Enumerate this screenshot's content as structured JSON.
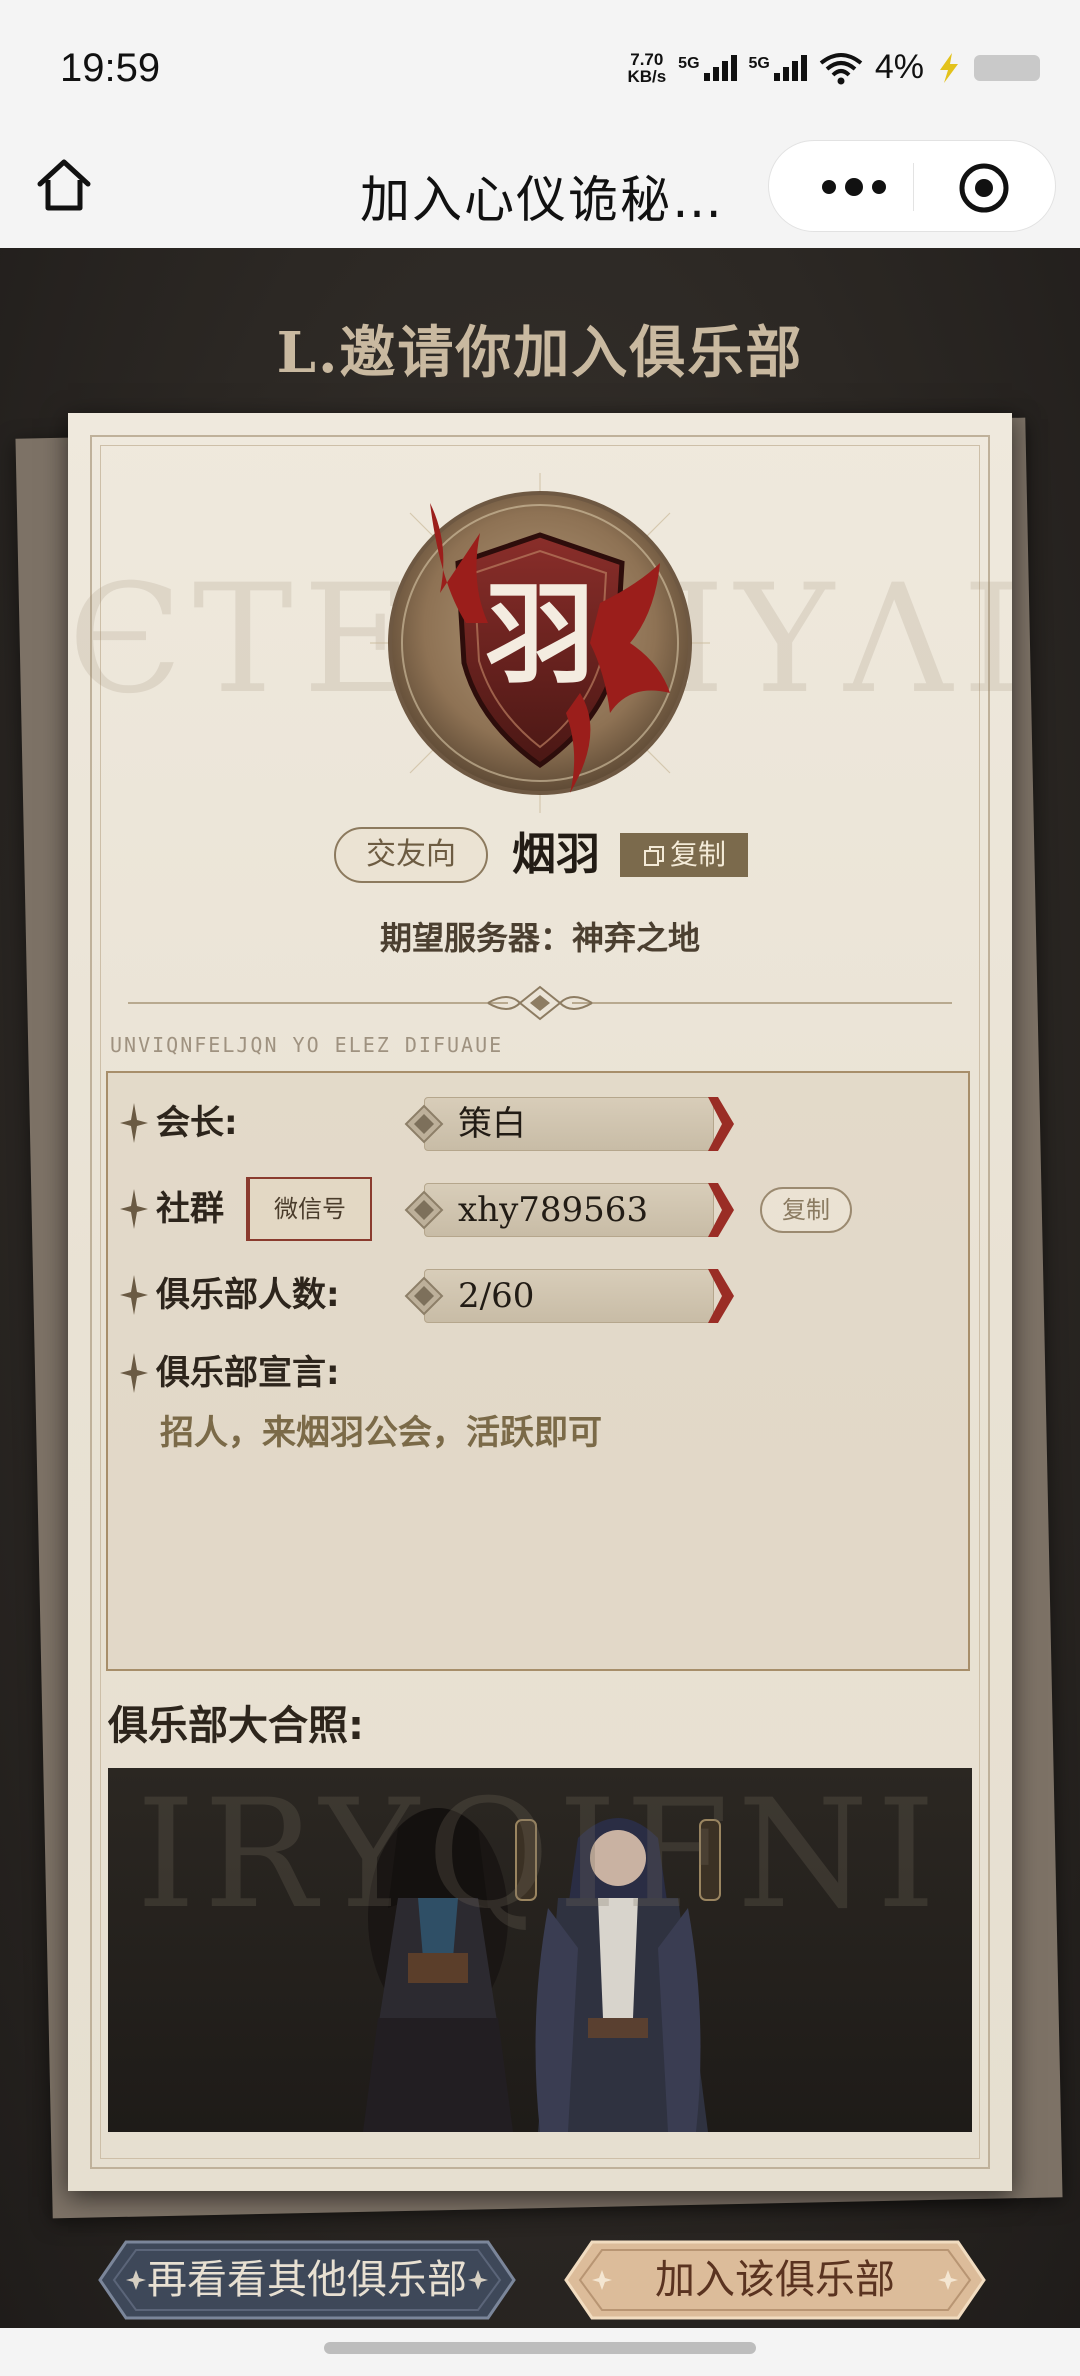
{
  "status_bar": {
    "time": "19:59",
    "net_speed_value": "7.70",
    "net_speed_unit": "KB/s",
    "sim1_label": "5G",
    "sim2_label": "5G",
    "battery_text": "4%"
  },
  "nav": {
    "title": "加入心仪诡秘…"
  },
  "page": {
    "heading": "L.邀请你加入俱乐部",
    "emblem_char": "羽",
    "tag_label": "交友向",
    "club_name": "烟羽",
    "copy_label": "复制",
    "server_text": "期望服务器：神弃之地",
    "rune_small": "UNVIQNFELJQN YO ELEZ DIFUAUE"
  },
  "info": {
    "leader_label": "会长:",
    "leader_value": "策白",
    "group_label": "社群",
    "group_type": "微信号",
    "group_value": "xhy789563",
    "group_copy": "复制",
    "members_label": "俱乐部人数:",
    "members_value": "2/60",
    "declaration_label": "俱乐部宣言:",
    "declaration_text": "招人，来烟羽公会，活跃即可"
  },
  "photo": {
    "title": "俱乐部大合照:"
  },
  "actions": {
    "other_clubs": "再看看其他俱乐部",
    "join_club": "加入该俱乐部"
  },
  "colors": {
    "accent_red": "#8a2a22",
    "paper": "#ece5d8",
    "join_button": "#d9b896",
    "other_button": "#3f4a5c"
  }
}
